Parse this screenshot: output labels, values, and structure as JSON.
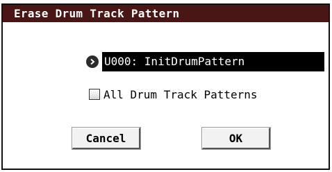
{
  "dialog": {
    "title": "Erase Drum Track Pattern",
    "pattern_field": {
      "value": "U000: InitDrumPattern",
      "arrow_icon": "play-circle-icon"
    },
    "all_patterns_checkbox": {
      "label": "All Drum Track Patterns",
      "checked": false
    },
    "buttons": {
      "cancel_label": "Cancel",
      "ok_label": "OK"
    }
  },
  "colors": {
    "titlebar_bg": "#4a1515",
    "field_bg": "#000000",
    "field_text": "#ffffff"
  }
}
